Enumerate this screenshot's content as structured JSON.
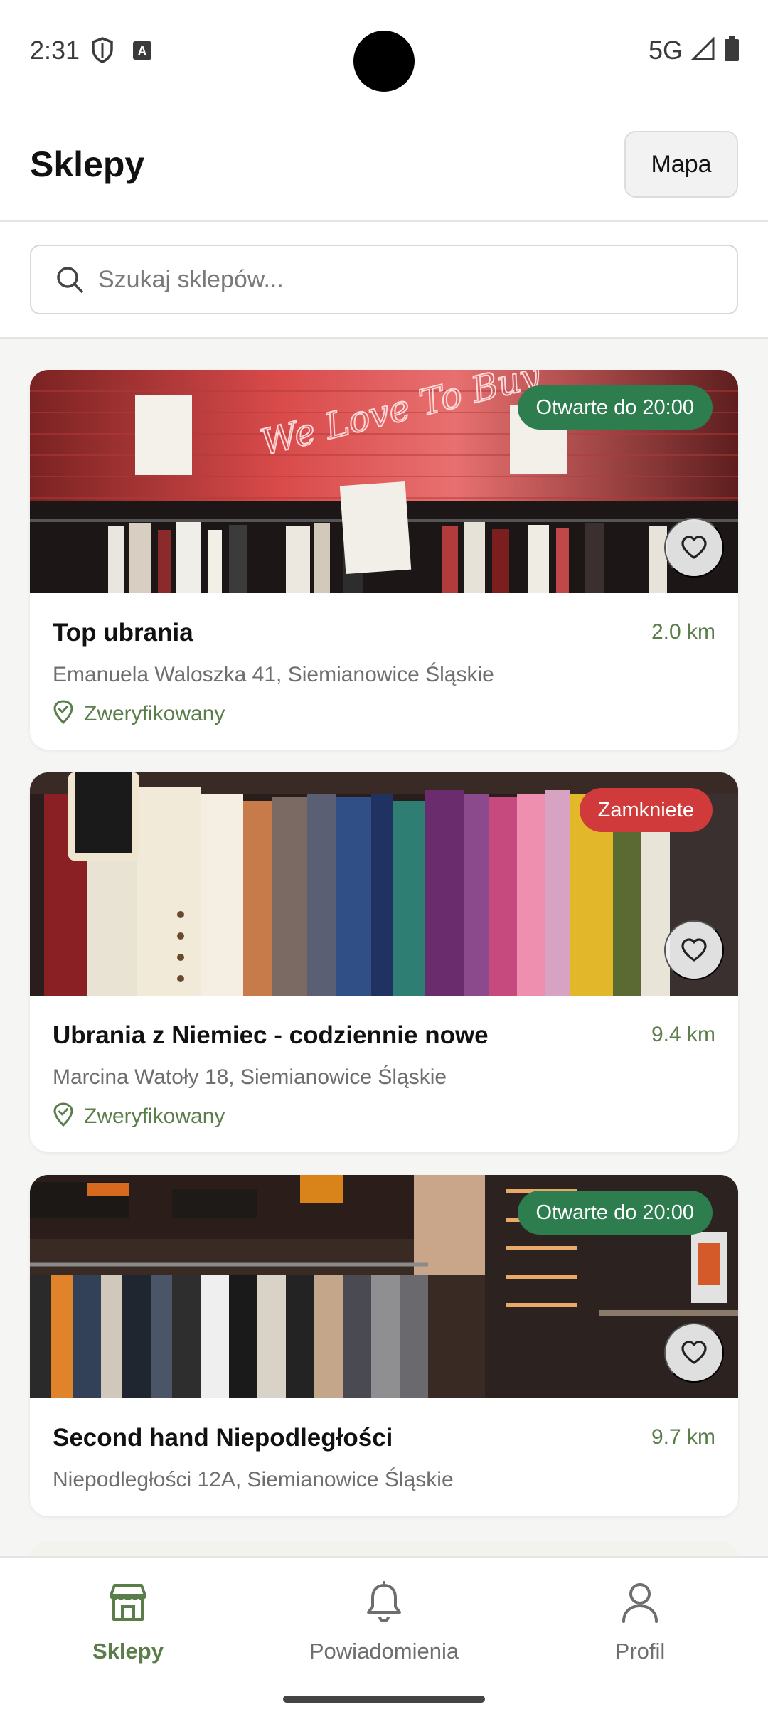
{
  "status_bar": {
    "time": "2:31",
    "network": "5G",
    "icons": [
      "shield-icon",
      "a-badge-icon",
      "signal-icon",
      "battery-icon"
    ]
  },
  "header": {
    "title": "Sklepy",
    "map_button": "Mapa"
  },
  "search": {
    "placeholder": "Szukaj sklepów..."
  },
  "shops": [
    {
      "name": "Top ubrania",
      "distance": "2.0 km",
      "address": "Emanuela Waloszka 41, Siemianowice Śląskie",
      "status": "Otwarte do 20:00",
      "status_color": "#2e7d4f",
      "verified_label": "Zweryfikowany",
      "image_sign_text": "We Love To Buy"
    },
    {
      "name": "Ubrania z Niemiec - codziennie nowe",
      "distance": "9.4 km",
      "address": "Marcina Watoły 18, Siemianowice Śląskie",
      "status": "Zamkniete",
      "status_color": "#d03a3a",
      "verified_label": "Zweryfikowany"
    },
    {
      "name": "Second hand Niepodległości",
      "distance": "9.7 km",
      "address": "Niepodległości 12A, Siemianowice Śląskie",
      "status": "Otwarte do 20:00",
      "status_color": "#2e7d4f"
    }
  ],
  "bottom_nav": {
    "items": [
      {
        "label": "Sklepy",
        "icon": "store-icon",
        "active": true
      },
      {
        "label": "Powiadomienia",
        "icon": "bell-icon",
        "active": false
      },
      {
        "label": "Profil",
        "icon": "person-icon",
        "active": false
      }
    ]
  },
  "colors": {
    "accent_green": "#5a7d4a",
    "open_pill": "#2e7d4f",
    "closed_pill": "#d03a3a"
  }
}
